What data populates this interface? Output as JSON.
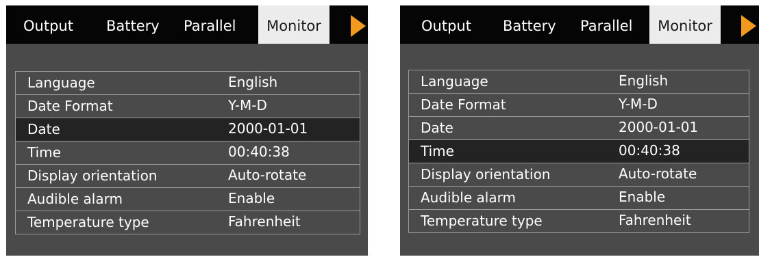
{
  "tabs": {
    "output": "Output",
    "battery": "Battery",
    "parallel": "Parallel",
    "monitor": "Monitor"
  },
  "settings": {
    "language": {
      "label": "Language",
      "value": "English"
    },
    "date_format": {
      "label": "Date Format",
      "value": "Y-M-D"
    },
    "date": {
      "label": "Date",
      "value": "2000-01-01"
    },
    "time": {
      "label": "Time",
      "value": "00:40:38"
    },
    "display_orientation": {
      "label": "Display orientation",
      "value": "Auto-rotate"
    },
    "audible_alarm": {
      "label": "Audible alarm",
      "value": "Enable"
    },
    "temperature_type": {
      "label": "Temperature type",
      "value": "Fahrenheit"
    }
  },
  "colors": {
    "screen_bg": "#4a4a4a",
    "tabbar_bg": "#050505",
    "active_tab_bg": "#ececec",
    "selected_row_bg": "#232323",
    "arrow": "#f29a1f"
  },
  "icons": {
    "next_tab": "orange-triangle-right-icon"
  },
  "screens": {
    "left": {
      "selected_row": "date"
    },
    "right": {
      "selected_row": "time"
    }
  }
}
